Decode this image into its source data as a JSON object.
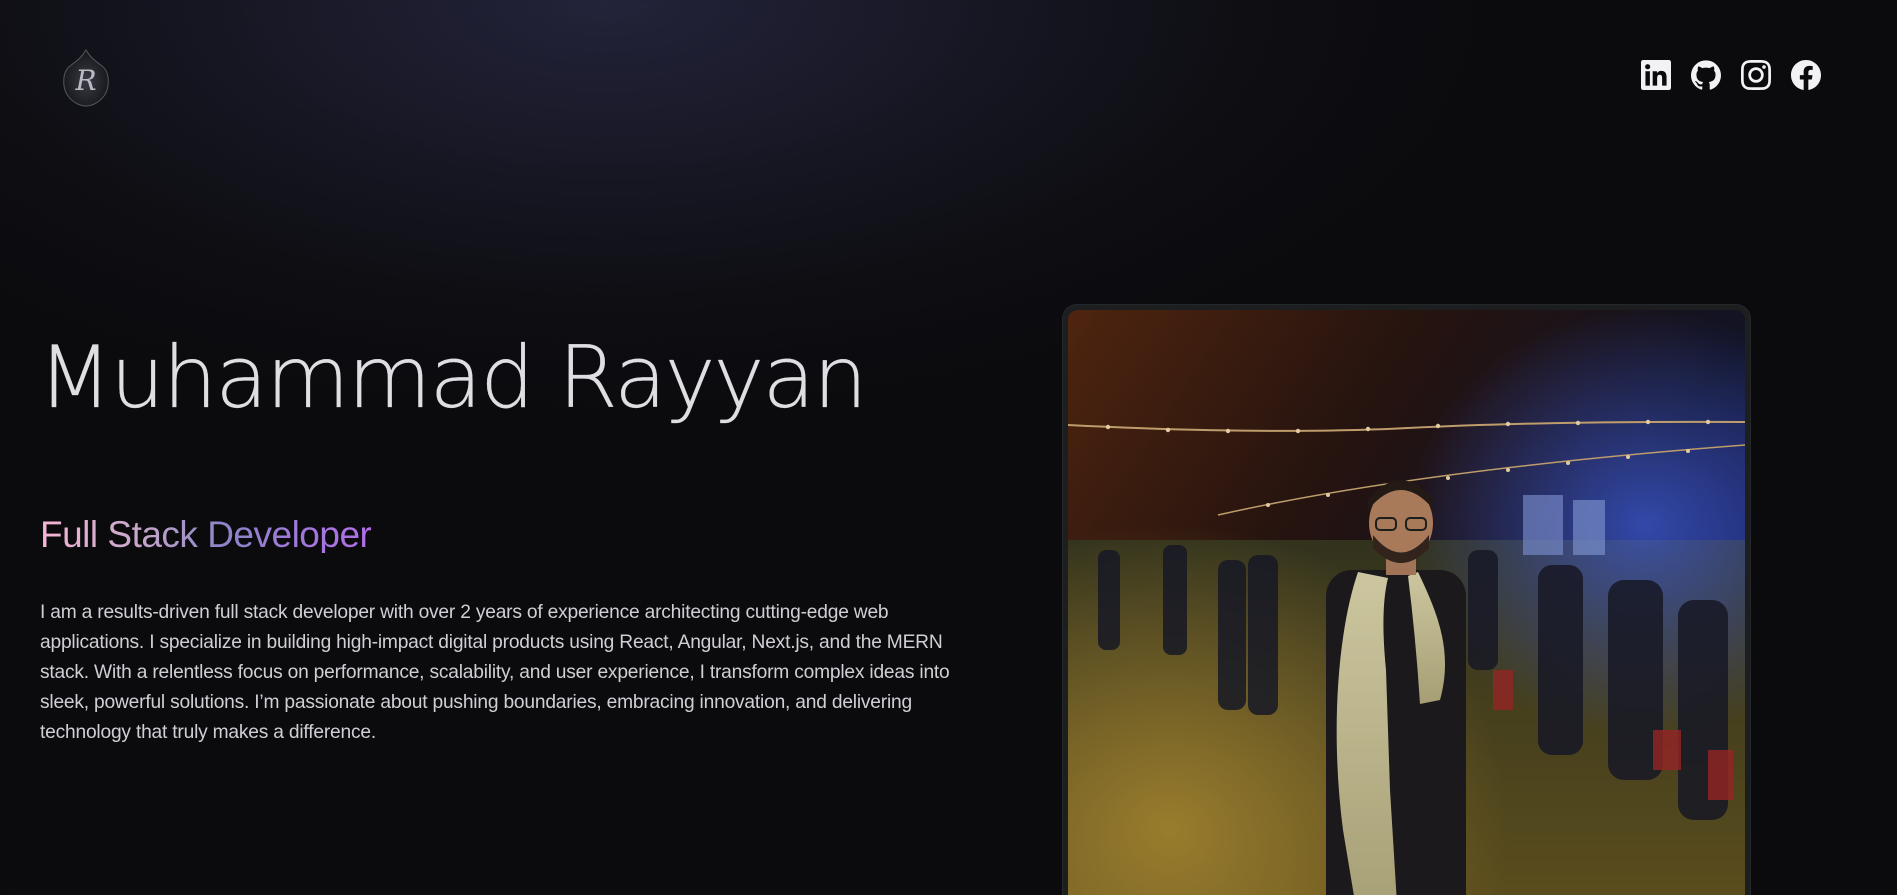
{
  "header": {
    "logo": {
      "alt": "R logo",
      "letter": "R"
    },
    "social": [
      {
        "name": "LinkedIn",
        "icon": "linkedin-icon"
      },
      {
        "name": "GitHub",
        "icon": "github-icon"
      },
      {
        "name": "Instagram",
        "icon": "instagram-icon"
      },
      {
        "name": "Facebook",
        "icon": "facebook-icon"
      }
    ]
  },
  "hero": {
    "name": "Muhammad Rayyan",
    "role": "Full Stack Developer",
    "bio": "I am a results-driven full stack developer with over 2 years of experience architecting cutting-edge web applications. I specialize in building high-impact digital products using React, Angular, Next.js, and the MERN stack. With a relentless focus on performance, scalability, and user experience, I transform complex ideas into sleek, powerful solutions. I’m passionate about pushing boundaries, embracing innovation, and delivering technology that truly makes a difference."
  },
  "photo": {
    "alt": "Portrait of Muhammad Rayyan at an outdoor evening event"
  },
  "colors": {
    "background": "#0b0b0e",
    "text": "#ebebef",
    "role_gradient_start": "#f7b6d6",
    "role_gradient_end": "#b26ee9"
  }
}
